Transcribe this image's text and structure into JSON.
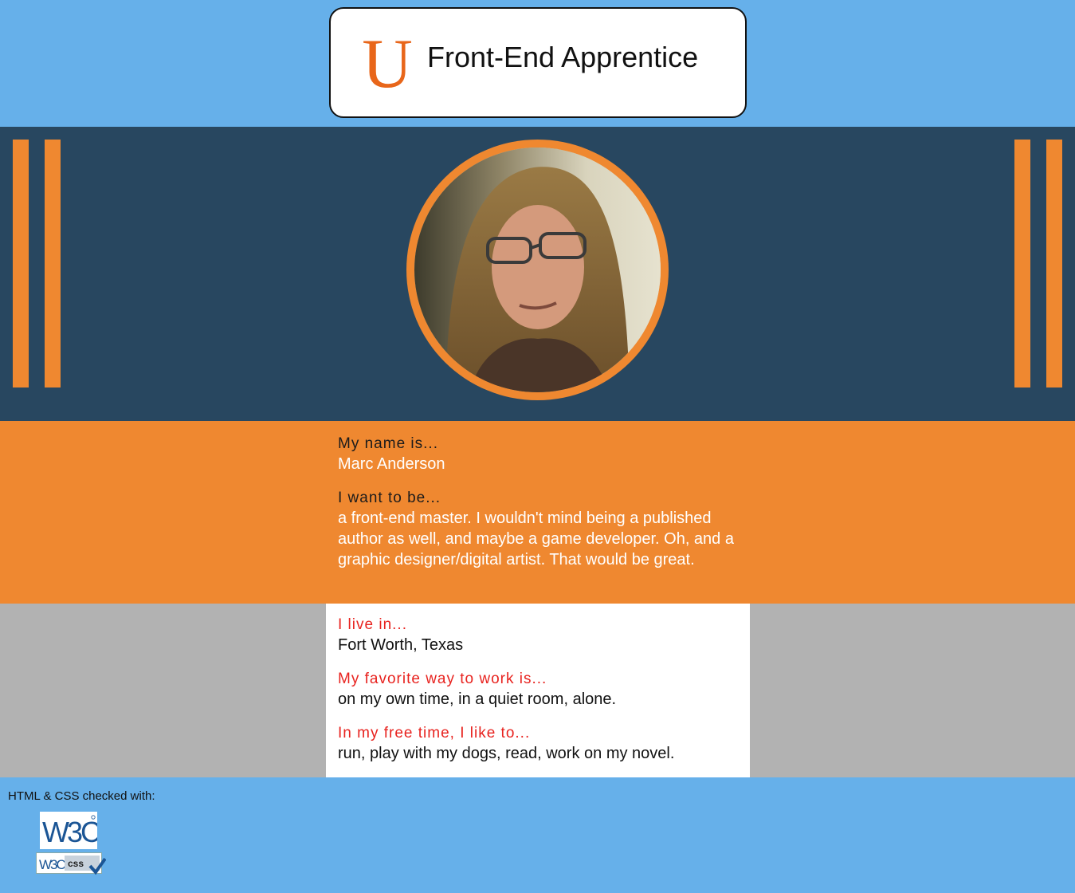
{
  "header": {
    "logo_letter": "U",
    "title": "Front-End Apprentice"
  },
  "hero": {
    "avatar_alt": "profile-photo"
  },
  "about": {
    "name_label": "My name is...",
    "name_value": "Marc Anderson",
    "goal_label": "I want to be...",
    "goal_value": "a front-end master. I wouldn't mind being a published author as well, and maybe a game developer. Oh, and a graphic designer/digital artist. That would be great."
  },
  "details": {
    "location_label": "I live in...",
    "location_value": "Fort Worth, Texas",
    "work_label": "My favorite way to work is...",
    "work_value": "on my own time, in a quiet room, alone.",
    "free_label": "In my free time, I like to...",
    "free_value": "run, play with my dogs, read, work on my novel."
  },
  "footer": {
    "checked_text": "HTML & CSS checked with:",
    "w3c_badge_text": "W3C",
    "css_badge_w3c": "W3C",
    "css_badge_css": "css"
  },
  "colors": {
    "sky": "#66b0ea",
    "navy": "#284760",
    "orange": "#ef8830",
    "gray": "#b2b2b2",
    "red_label": "#e8231f",
    "logo_orange": "#e8661a"
  }
}
